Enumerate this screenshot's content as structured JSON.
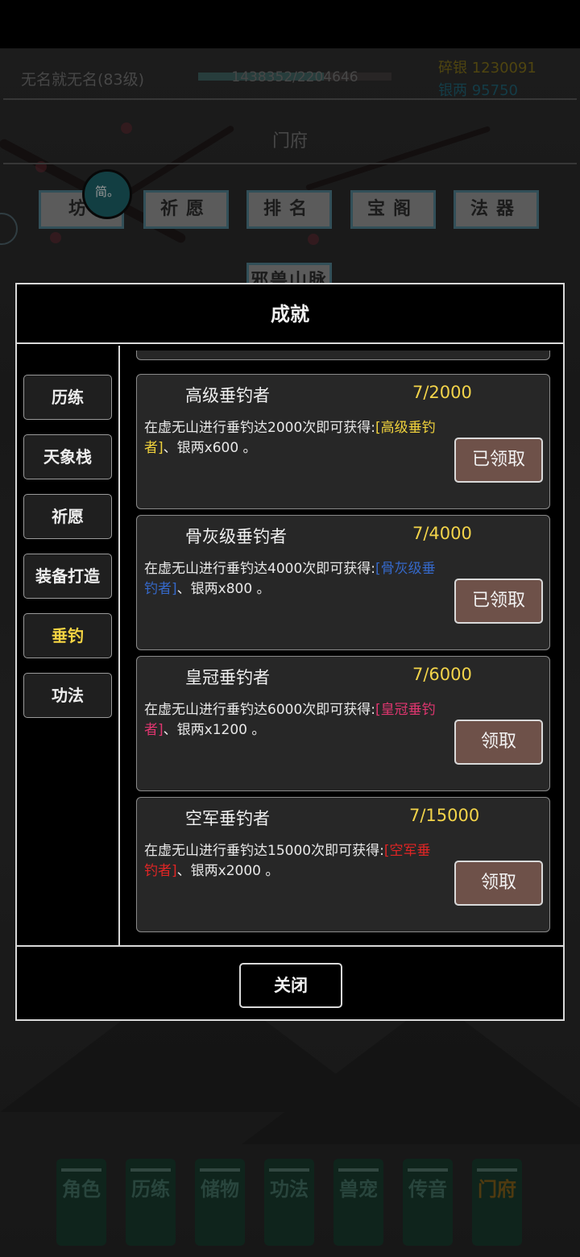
{
  "topbar": {
    "player_name": "无名就无名(83级)",
    "exp_text": "1438352/2204646",
    "exp_fraction": 0.652,
    "silver_fragments": "碎银 1230091",
    "silver_taels": "银两 95750"
  },
  "hall": {
    "title": "门府",
    "menu": [
      "坊",
      "祈愿",
      "排名",
      "宝阁",
      "法器"
    ],
    "partial_menu": "邪兽山脉",
    "avatar_text": "简。"
  },
  "dialog": {
    "title": "成就",
    "categories": [
      {
        "label": "历练",
        "active": false
      },
      {
        "label": "天象栈",
        "active": false
      },
      {
        "label": "祈愿",
        "active": false
      },
      {
        "label": "装备打造",
        "active": false
      },
      {
        "label": "垂钓",
        "active": true
      },
      {
        "label": "功法",
        "active": false
      }
    ],
    "achievements": [
      {
        "name": "高级垂钓者",
        "progress": "7/2000",
        "desc_prefix": "在虚无山进行垂钓达2000次即可获得:",
        "reward_title": "[高级垂钓者]",
        "desc_suffix": "、银两x600 。",
        "reward_color": "#f0d23c",
        "button": "已领取"
      },
      {
        "name": "骨灰级垂钓者",
        "progress": "7/4000",
        "desc_prefix": "在虚无山进行垂钓达4000次即可获得:",
        "reward_title": "[骨灰级垂钓者]",
        "desc_suffix": "、银两x800 。",
        "reward_color": "#3568c8",
        "button": "已领取"
      },
      {
        "name": "皇冠垂钓者",
        "progress": "7/6000",
        "desc_prefix": "在虚无山进行垂钓达6000次即可获得:",
        "reward_title": "[皇冠垂钓者]",
        "desc_suffix": "、银两x1200 。",
        "reward_color": "#e03670",
        "button": "领取"
      },
      {
        "name": "空军垂钓者",
        "progress": "7/15000",
        "desc_prefix": "在虚无山进行垂钓达15000次即可获得:",
        "reward_title": "[空军垂钓者]",
        "desc_suffix": "、银两x2000 。",
        "reward_color": "#e02525",
        "button": "领取"
      }
    ],
    "close_label": "关闭"
  },
  "bottom_nav": [
    {
      "label": "角色",
      "active": false
    },
    {
      "label": "历练",
      "active": false
    },
    {
      "label": "储物",
      "active": false
    },
    {
      "label": "功法",
      "active": false
    },
    {
      "label": "兽宠",
      "active": false
    },
    {
      "label": "传音",
      "active": false
    },
    {
      "label": "门府",
      "active": true
    }
  ]
}
